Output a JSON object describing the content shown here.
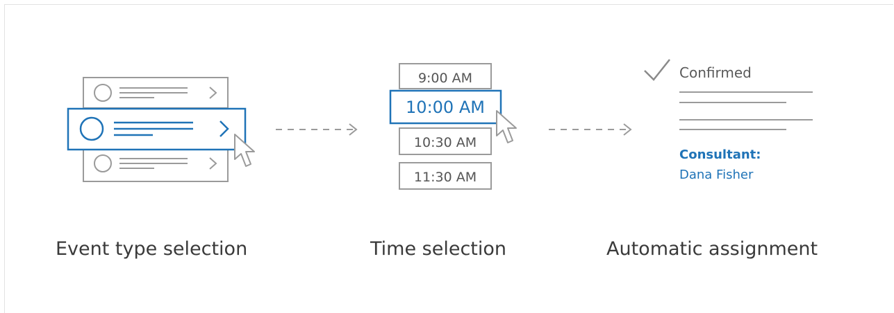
{
  "colors": {
    "accent": "#1f73b7",
    "outline": "#9a9a9a",
    "text": "#3a3a3a",
    "muted": "#666666"
  },
  "steps": [
    {
      "caption": "Event type selection"
    },
    {
      "caption": "Time selection"
    },
    {
      "caption": "Automatic assignment"
    }
  ],
  "time_slots": [
    {
      "label": "9:00 AM",
      "selected": false
    },
    {
      "label": "10:00 AM",
      "selected": true
    },
    {
      "label": "10:30 AM",
      "selected": false
    },
    {
      "label": "11:30 AM",
      "selected": false
    }
  ],
  "confirmation": {
    "status": "Confirmed",
    "role_label": "Consultant:",
    "person_name": "Dana Fisher"
  },
  "icons": {
    "check": "check-icon",
    "cursor": "cursor-pointer-icon",
    "arrow": "dashed-arrow-icon",
    "radio": "radio-circle-icon",
    "chevron": "chevron-right-icon"
  }
}
